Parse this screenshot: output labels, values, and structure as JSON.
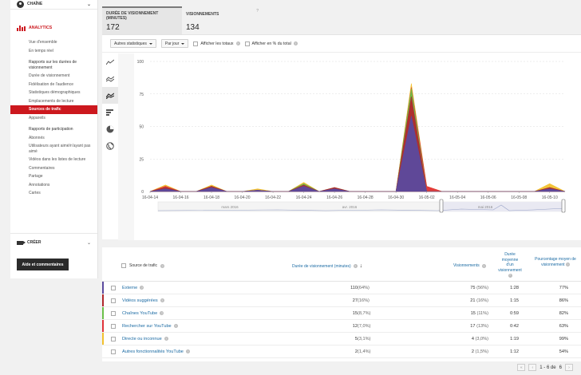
{
  "sidebar": {
    "channel_label": "CHAÎNE",
    "analytics_label": "ANALYTICS",
    "items": [
      {
        "label": "Vue d'ensemble",
        "type": "item"
      },
      {
        "label": "En temps réel",
        "type": "item"
      },
      {
        "label": "Rapports sur les durées de visionnement",
        "type": "section"
      },
      {
        "label": "Durée de visionnement",
        "type": "item"
      },
      {
        "label": "Fidélisation de l'audience",
        "type": "item"
      },
      {
        "label": "Statistiques démographiques",
        "type": "item"
      },
      {
        "label": "Emplacements de lecture",
        "type": "item"
      },
      {
        "label": "Sources de trafic",
        "type": "active"
      },
      {
        "label": "Appareils",
        "type": "item"
      },
      {
        "label": "Rapports de participation",
        "type": "section"
      },
      {
        "label": "Abonnés",
        "type": "item"
      },
      {
        "label": "Utilisateurs ayant aimé/n'ayant pas aimé",
        "type": "item"
      },
      {
        "label": "Vidéos dans les listes de lecture",
        "type": "item"
      },
      {
        "label": "Commentaires",
        "type": "item"
      },
      {
        "label": "Partage",
        "type": "item"
      },
      {
        "label": "Annotations",
        "type": "item"
      },
      {
        "label": "Cartes",
        "type": "item"
      }
    ],
    "create_label": "CRÉER",
    "help_button": "Aide et commentaires"
  },
  "metrics": [
    {
      "label": "DURÉE DE VISIONNEMENT (MINUTES)",
      "value": "172"
    },
    {
      "label": "VISIONNEMENTS",
      "value": "134"
    }
  ],
  "toolbar": {
    "stats_dropdown": "Autres statistiques",
    "period_dropdown": "Par jour",
    "show_totals": "Afficher les totaux",
    "show_percent": "Afficher en % du total"
  },
  "chart_data": {
    "type": "area",
    "x": [
      "16-04-14",
      "16-04-15",
      "16-04-16",
      "16-04-17",
      "16-04-18",
      "16-04-19",
      "16-04-20",
      "16-04-21",
      "16-04-22",
      "16-04-23",
      "16-04-24",
      "16-04-25",
      "16-04-26",
      "16-04-27",
      "16-04-28",
      "16-04-29",
      "16-04-30",
      "16-05-01",
      "16-05-02",
      "16-05-03",
      "16-05-04",
      "16-05-05",
      "16-05-06",
      "16-05-07",
      "16-05-08",
      "16-05-09",
      "16-05-10",
      "16-05-11"
    ],
    "xticks": [
      "16-04-14",
      "16-04-16",
      "16-04-18",
      "16-04-20",
      "16-04-22",
      "16-04-24",
      "16-04-26",
      "16-04-28",
      "16-04-30",
      "16-05-02",
      "16-05-04",
      "16-05-06",
      "16-05-08",
      "16-05-10"
    ],
    "ylim": [
      0,
      100
    ],
    "yticks": [
      0,
      25,
      50,
      75,
      100
    ],
    "series": [
      {
        "name": "Externe",
        "color": "#5b4a9e",
        "values": [
          0,
          2,
          0,
          0,
          3,
          0,
          0,
          1,
          0,
          0,
          4,
          0,
          2,
          0,
          0,
          0,
          0,
          58,
          0,
          0,
          0,
          0,
          0,
          0,
          0,
          0,
          2,
          0
        ]
      },
      {
        "name": "Vidéos suggérées",
        "color": "#b0282d",
        "values": [
          0,
          1,
          0,
          0,
          1,
          0,
          0,
          0,
          0,
          0,
          1,
          0,
          1,
          0,
          0,
          0,
          0,
          15,
          0,
          0,
          0,
          0,
          0,
          0,
          0,
          0,
          1,
          0
        ]
      },
      {
        "name": "Chaînes YouTube",
        "color": "#6cc04a",
        "values": [
          0,
          0,
          0,
          0,
          0,
          0,
          0,
          0,
          0,
          0,
          1,
          0,
          0,
          0,
          0,
          0,
          0,
          6,
          0,
          0,
          0,
          0,
          0,
          0,
          0,
          0,
          0,
          0
        ]
      },
      {
        "name": "Rechercher sur YouTube",
        "color": "#e0343a",
        "values": [
          0,
          1,
          0,
          0,
          0,
          0,
          0,
          0,
          0,
          0,
          0,
          0,
          0,
          0,
          0,
          0,
          0,
          1,
          4,
          0,
          0,
          0,
          0,
          0,
          0,
          0,
          0,
          0
        ]
      },
      {
        "name": "Directe ou inconnue",
        "color": "#f2c12e",
        "values": [
          0,
          1,
          0,
          0,
          1,
          0,
          0,
          1,
          0,
          0,
          1,
          0,
          0,
          0,
          0,
          0,
          0,
          3,
          0,
          0,
          0,
          0,
          0,
          0,
          0,
          0,
          3,
          0
        ]
      }
    ],
    "nav_labels": [
      "mars 2016",
      "avr. 2016",
      "mai 2016"
    ]
  },
  "table": {
    "headers": {
      "source": "Source de trafic",
      "duration": "Durée de visionnement (minutes)",
      "views": "Visionnements",
      "avg_duration": "Durée moyenne d'un visionnement",
      "avg_pct": "Pourcentage moyen de visionnement"
    },
    "rows": [
      {
        "name": "Externe",
        "duration": "110",
        "duration_pct": "(64%)",
        "views": "75",
        "views_pct": "(56%)",
        "avg": "1:28",
        "pct": "77%",
        "color": "#5b4a9e"
      },
      {
        "name": "Vidéos suggérées",
        "duration": "27",
        "duration_pct": "(16%)",
        "views": "21",
        "views_pct": "(16%)",
        "avg": "1:15",
        "pct": "86%",
        "color": "#b0282d"
      },
      {
        "name": "Chaînes YouTube",
        "duration": "15",
        "duration_pct": "(8,7%)",
        "views": "15",
        "views_pct": "(11%)",
        "avg": "0:59",
        "pct": "82%",
        "color": "#6cc04a"
      },
      {
        "name": "Rechercher sur YouTube",
        "duration": "12",
        "duration_pct": "(7,0%)",
        "views": "17",
        "views_pct": "(13%)",
        "avg": "0:42",
        "pct": "63%",
        "color": "#e0343a"
      },
      {
        "name": "Directe ou inconnue",
        "duration": "5",
        "duration_pct": "(3,1%)",
        "views": "4",
        "views_pct": "(3,0%)",
        "avg": "1:19",
        "pct": "99%",
        "color": "#f2c12e"
      },
      {
        "name": "Autres fonctionnalités YouTube",
        "duration": "2",
        "duration_pct": "(1,4%)",
        "views": "2",
        "views_pct": "(1,5%)",
        "avg": "1:12",
        "pct": "54%",
        "color": "#ffffff"
      }
    ]
  },
  "pager": {
    "text": "1 - 6 de",
    "total": "6"
  }
}
